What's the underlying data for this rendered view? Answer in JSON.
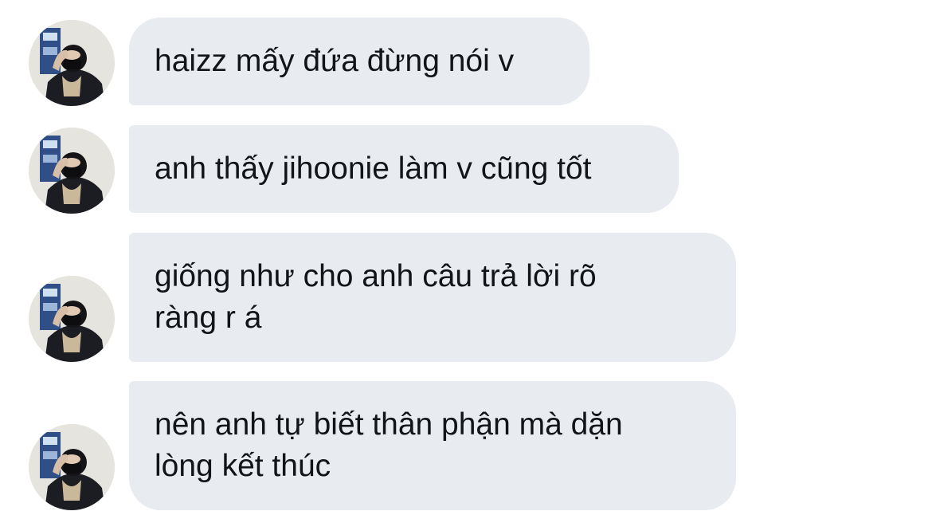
{
  "messages": [
    {
      "sender_avatar": "user-avatar",
      "text": "haizz mấy đứa đừng nói v"
    },
    {
      "sender_avatar": "user-avatar",
      "text": "anh thấy jihoonie làm v cũng tốt"
    },
    {
      "sender_avatar": "user-avatar",
      "text": "giống như cho anh câu trả lời rõ\nràng r á"
    },
    {
      "sender_avatar": "user-avatar",
      "text": "nên anh tự biết thân phận mà dặn\nlòng kết thúc"
    }
  ],
  "colors": {
    "bubble_bg": "#e8ebef",
    "text": "#111418",
    "page_bg": "#ffffff"
  }
}
